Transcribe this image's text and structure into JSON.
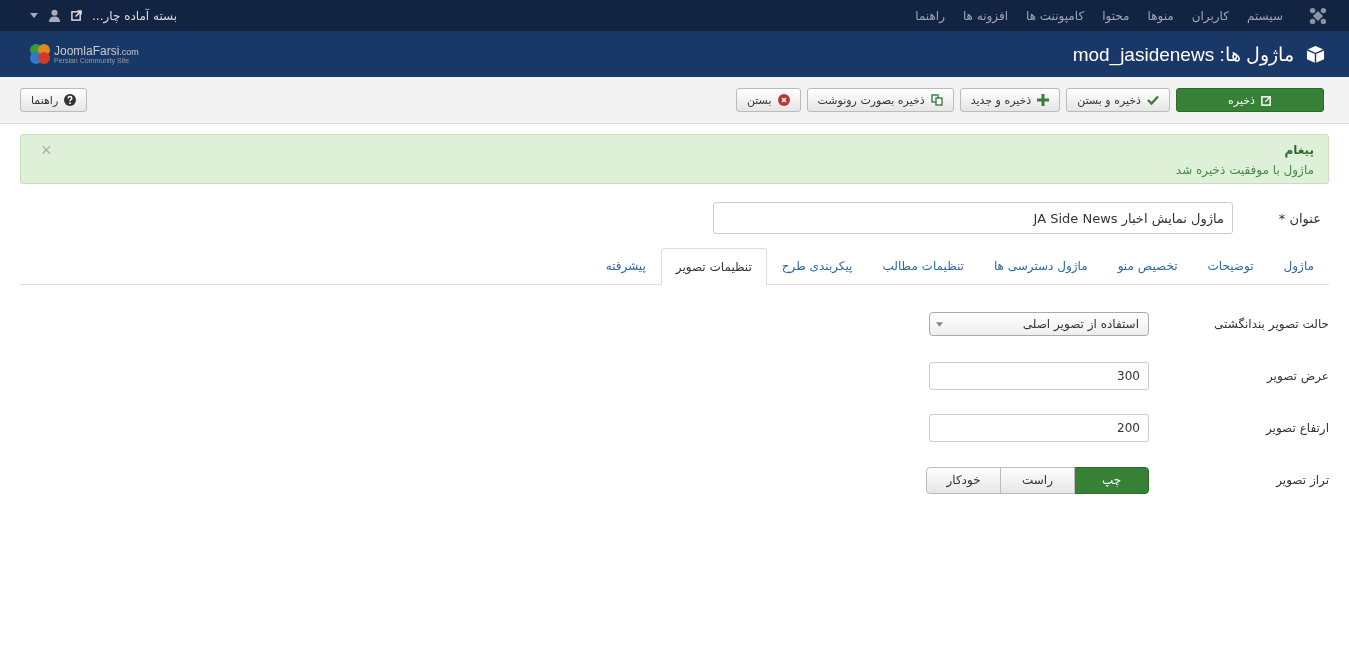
{
  "top_menu": [
    "سیستم",
    "کاربران",
    "منوها",
    "محتوا",
    "کامپوننت ها",
    "افزونه ها",
    "راهنما"
  ],
  "site_link": "بسته آماده چار...",
  "logo": {
    "name": "JoomlaFarsi",
    "suffix": ".com",
    "tagline": "Persian Community Site"
  },
  "page_title": "ماژول ها: mod_jasidenews",
  "toolbar": [
    {
      "label": "ذخیره",
      "kind": "save"
    },
    {
      "label": "ذخیره و بستن",
      "kind": "check"
    },
    {
      "label": "ذخیره و جدید",
      "kind": "plus"
    },
    {
      "label": "ذخیره بصورت رونوشت",
      "kind": "copy"
    },
    {
      "label": "بستن",
      "kind": "cancel"
    }
  ],
  "help_button": "راهنما",
  "alert": {
    "heading": "پیغام",
    "text": "ماژول با موفقیت ذخیره شد",
    "close": "×"
  },
  "title_field": {
    "label": "عنوان *",
    "value": "ماژول نمایش اخبار JA Side News"
  },
  "tabs": [
    {
      "label": "ماژول",
      "selected": false
    },
    {
      "label": "توضیحات",
      "selected": false
    },
    {
      "label": "تخصیص منو",
      "selected": false
    },
    {
      "label": "ماژول دسترسی ها",
      "selected": false
    },
    {
      "label": "تنظیمات مطالب",
      "selected": false
    },
    {
      "label": "پیکربندی طرح",
      "selected": false
    },
    {
      "label": "تنظیمات تصویر",
      "selected": true
    },
    {
      "label": "پیشرفته",
      "selected": false
    }
  ],
  "fields": [
    {
      "kind": "select",
      "label": "حالت تصویر بندانگشتی",
      "value": "استفاده از تصویر اصلی"
    },
    {
      "kind": "text",
      "label": "عرض تصویر",
      "value": "300"
    },
    {
      "kind": "text",
      "label": "ارتفاع تصویر",
      "value": "200"
    },
    {
      "kind": "radio",
      "label": "تراز تصویر",
      "options": [
        {
          "label": "چپ",
          "selected": true
        },
        {
          "label": "راست",
          "selected": false
        },
        {
          "label": "خودکار",
          "selected": false
        }
      ]
    }
  ]
}
